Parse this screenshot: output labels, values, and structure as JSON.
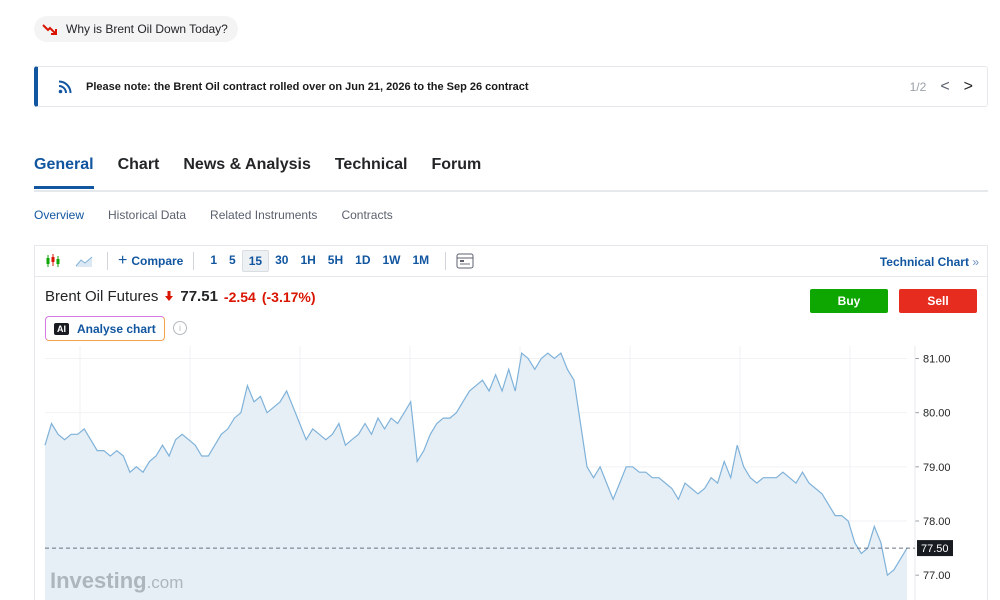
{
  "pill": {
    "label": "Why is Brent Oil Down Today?"
  },
  "notice": {
    "text": "Please note: the Brent Oil contract rolled over on Jun 21, 2026 to the Sep 26 contract",
    "pager": "1/2",
    "prev": "<",
    "next": ">"
  },
  "tabs": [
    "General",
    "Chart",
    "News & Analysis",
    "Technical",
    "Forum"
  ],
  "subnav": [
    "Overview",
    "Historical Data",
    "Related Instruments",
    "Contracts"
  ],
  "toolbar": {
    "compare_label": "Compare",
    "intervals": [
      "1",
      "5",
      "15",
      "30",
      "1H",
      "5H",
      "1D",
      "1W",
      "1M"
    ],
    "active_interval": "15",
    "technical_chart": "Technical Chart",
    "technical_chart_suffix": "»"
  },
  "instrument": {
    "name": "Brent Oil Futures",
    "price": "77.51",
    "change": "-2.54",
    "change_pct": "(-3.17%)"
  },
  "actions": {
    "buy": "Buy",
    "sell": "Sell"
  },
  "ai": {
    "badge": "AI",
    "label": "Analyse chart",
    "info": "i"
  },
  "watermark": {
    "main": "Investing",
    "suffix": ".com"
  },
  "colors": {
    "accent": "#1256a0",
    "down": "#d91400",
    "buy": "#0ea600",
    "sell": "#e52c1e",
    "line": "#7fb2d9",
    "area": "#e6eef6"
  },
  "chart_data": {
    "type": "area",
    "ylim": [
      76.8,
      81.6
    ],
    "yticks": [
      "81.00",
      "80.00",
      "79.00",
      "78.00",
      "77.00"
    ],
    "current_label": "77.50",
    "current_value": 77.5,
    "values": [
      79.4,
      79.8,
      79.6,
      79.5,
      79.6,
      79.6,
      79.7,
      79.5,
      79.3,
      79.3,
      79.2,
      79.3,
      79.2,
      78.9,
      79.0,
      78.9,
      79.1,
      79.2,
      79.4,
      79.2,
      79.5,
      79.6,
      79.5,
      79.4,
      79.2,
      79.2,
      79.4,
      79.6,
      79.7,
      79.9,
      80.0,
      80.5,
      80.2,
      80.3,
      80.0,
      80.1,
      80.2,
      80.4,
      80.1,
      79.8,
      79.5,
      79.7,
      79.6,
      79.5,
      79.6,
      79.8,
      79.4,
      79.5,
      79.6,
      79.8,
      79.6,
      79.9,
      79.7,
      79.9,
      79.8,
      80.0,
      80.2,
      79.1,
      79.3,
      79.6,
      79.8,
      79.9,
      79.9,
      80.0,
      80.2,
      80.4,
      80.5,
      80.6,
      80.4,
      80.7,
      80.4,
      80.8,
      80.4,
      81.1,
      81.0,
      80.8,
      81.0,
      81.1,
      81.0,
      81.1,
      80.8,
      80.6,
      79.8,
      79.0,
      78.8,
      79.0,
      78.7,
      78.4,
      78.7,
      79.0,
      79.0,
      78.9,
      78.9,
      78.8,
      78.8,
      78.7,
      78.6,
      78.4,
      78.7,
      78.6,
      78.5,
      78.6,
      78.8,
      78.7,
      79.1,
      78.8,
      79.4,
      79.0,
      78.8,
      78.7,
      78.8,
      78.8,
      78.8,
      78.9,
      78.8,
      78.7,
      78.9,
      78.7,
      78.6,
      78.5,
      78.3,
      78.1,
      78.1,
      78.0,
      77.6,
      77.4,
      77.5,
      77.9,
      77.6,
      77.0,
      77.1,
      77.3,
      77.5
    ]
  }
}
